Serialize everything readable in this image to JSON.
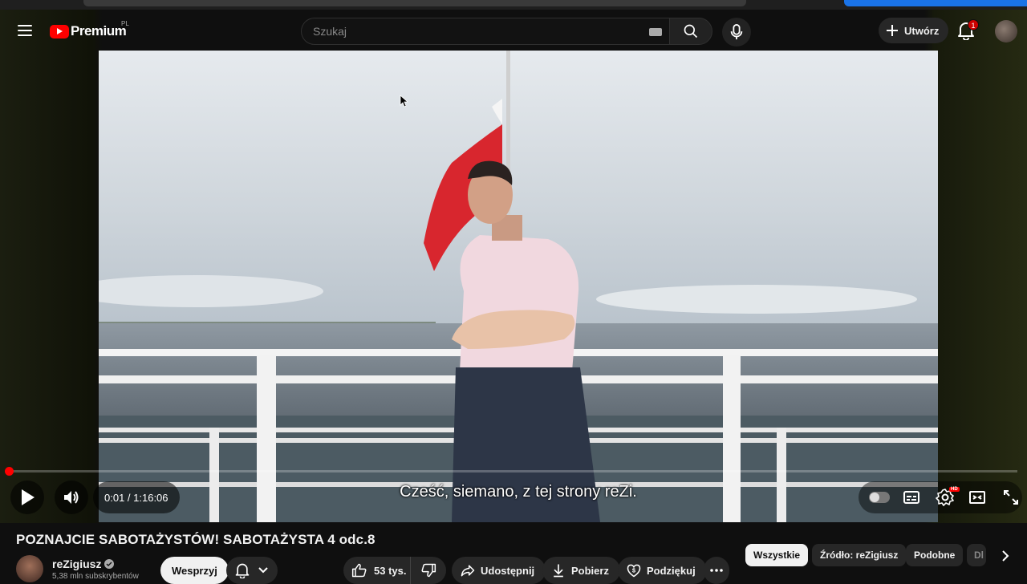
{
  "masthead": {
    "logo_text": "Premium",
    "country_code": "PL",
    "search_placeholder": "Szukaj",
    "create_label": "Utwórz",
    "notification_count": "1"
  },
  "player": {
    "time_display": "0:01 / 1:16:06",
    "progress_fraction": 0.0002,
    "subtitle": "Cześć, siemano, z tej strony reZi."
  },
  "video": {
    "title": "POZNAJCIE SABOTAŻYSTÓW! SABOTAŻYSTA 4 odc.8"
  },
  "channel": {
    "name": "reZigiusz",
    "subscribers": "5,38 mln subskrybentów",
    "support_label": "Wesprzyj"
  },
  "actions": {
    "likes": "53 tys.",
    "share": "Udostępnij",
    "download": "Pobierz",
    "thanks": "Podziękuj"
  },
  "chips": [
    {
      "label": "Wszystkie"
    },
    {
      "label": "Źródło: reZigiusz"
    },
    {
      "label": "Podobne"
    },
    {
      "label": "Dl"
    }
  ],
  "colors": {
    "brand_red": "#ff0000",
    "background": "#0f0f0f"
  }
}
